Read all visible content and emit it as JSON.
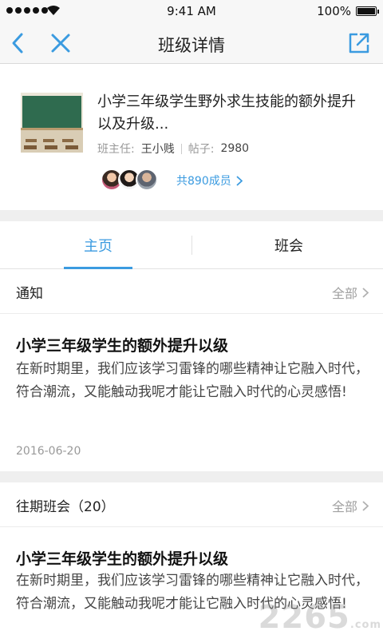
{
  "status_bar": {
    "time": "9:41 AM",
    "battery": "100%"
  },
  "nav": {
    "title": "班级详情"
  },
  "class_info": {
    "title": "小学三年级学生野外求生技能的额外提升以及升级...",
    "teacher_label": "班主任:",
    "teacher_name": "王小贱",
    "posts_label": "帖子:",
    "posts_count": "2980",
    "members_link": "共890成员"
  },
  "tabs": [
    {
      "label": "主页",
      "active": true
    },
    {
      "label": "班会",
      "active": false
    }
  ],
  "notice": {
    "header": "通知",
    "all_label": "全部",
    "title": "小学三年级学生的额外提升以级",
    "body": "在新时期里，我们应该学习雷锋的哪些精神让它融入时代，符合潮流，又能触动我呢才能让它融入时代的心灵感悟!",
    "date": "2016-06-20"
  },
  "past_meetings": {
    "header": "往期班会（20）",
    "all_label": "全部",
    "title": "小学三年级学生的额外提升以级",
    "body": "在新时期里，我们应该学习雷锋的哪些精神让它融入时代，符合潮流，又能触动我呢才能让它融入时代的心灵感悟!"
  },
  "watermark": {
    "main": "2265",
    "suffix": ".com"
  },
  "colors": {
    "accent": "#3b9be0",
    "muted": "#999999",
    "background": "#efefef"
  },
  "icons": [
    "back-arrow-icon",
    "close-icon",
    "share-icon",
    "chevron-right-icon",
    "wifi-icon"
  ]
}
